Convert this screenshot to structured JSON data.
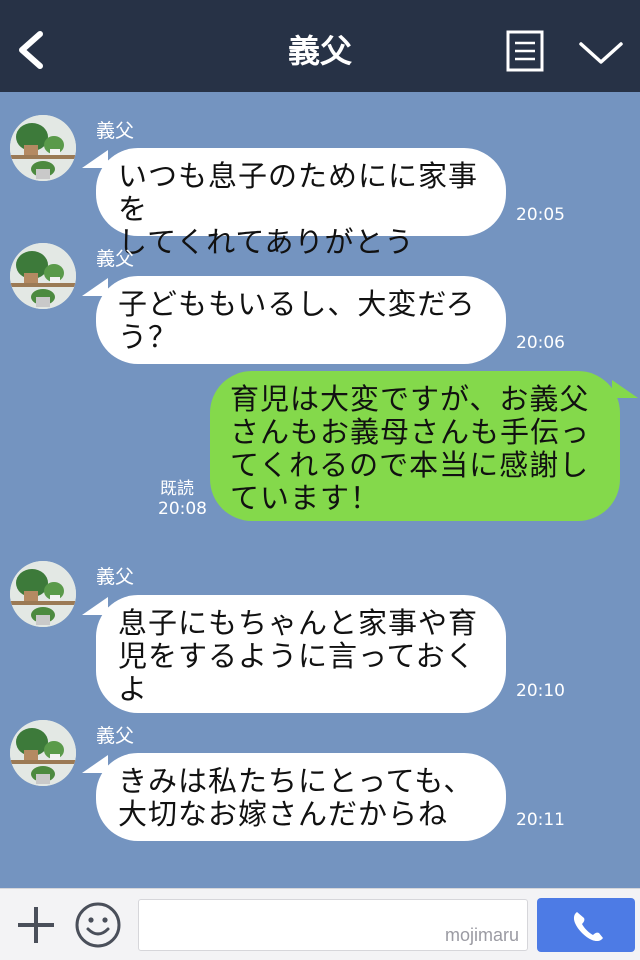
{
  "header": {
    "title": "義父",
    "back_icon": "chevron-left-icon",
    "memo_icon": "memo-icon",
    "menu_icon": "chevron-down-icon",
    "background": "#273246"
  },
  "chat": {
    "background": "#7494c0",
    "messages": [
      {
        "direction": "incoming",
        "sender": "義父",
        "text": "いつも息子のためにに家事を\nしてくれてありがとう",
        "time": "20:05"
      },
      {
        "direction": "incoming",
        "sender": "義父",
        "text": "子どももいるし、大変だろ\nう？",
        "time": "20:06"
      },
      {
        "direction": "outgoing",
        "text": "育児は大変ですが、お義父\nさんもお義母さんも手伝っ\nてくれるので本当に感謝し\nています！",
        "read": "既読",
        "time": "20:08"
      },
      {
        "direction": "incoming",
        "sender": "義父",
        "text": "息子にもちゃんと家事や育\n児をするように言っておく\nよ",
        "time": "20:10"
      },
      {
        "direction": "incoming",
        "sender": "義父",
        "text": "きみは私たちにとっても、\n大切なお嫁さんだからね",
        "time": "20:11"
      }
    ]
  },
  "input_bar": {
    "plus_icon": "plus-icon",
    "emoji_icon": "smiley-icon",
    "watermark": "mojimaru",
    "call_icon": "phone-icon",
    "accent": "#4d7be5"
  },
  "colors": {
    "incoming_bubble": "#ffffff",
    "outgoing_bubble": "#84d94b"
  }
}
